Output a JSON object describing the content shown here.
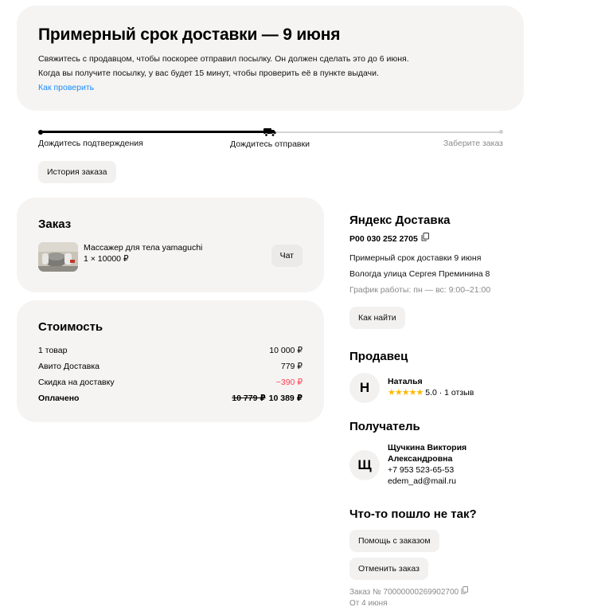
{
  "banner": {
    "title": "Примерный срок доставки — 9 июня",
    "line1": "Свяжитесь с продавцом, чтобы поскорее отправил посылку. Он должен сделать это до 6 июня.",
    "line2": "Когда вы получите посылку, у вас будет 15 минут, чтобы проверить её в пункте выдачи.",
    "link": "Как проверить"
  },
  "progress": {
    "steps": [
      "Дождитесь подтверждения",
      "Дождитесь отправки",
      "Заберите заказ"
    ],
    "current_step": 2
  },
  "history_button": "История заказа",
  "order": {
    "title": "Заказ",
    "item_name": "Массажер для тела yamaguchi",
    "item_qty": "1 × 10000 ₽",
    "chat_button": "Чат"
  },
  "cost": {
    "title": "Стоимость",
    "rows": [
      {
        "label": "1 товар",
        "value": "10 000 ₽"
      },
      {
        "label": "Авито Доставка",
        "value": "779 ₽"
      },
      {
        "label": "Скидка на доставку",
        "value": "−390 ₽"
      }
    ],
    "total_label": "Оплачено",
    "total_old": "10 779 ₽",
    "total_value": "10 389 ₽"
  },
  "delivery": {
    "title": "Яндекс Доставка",
    "tracking": "P00 030 252 2705",
    "eta": "Примерный срок доставки 9 июня",
    "address": "Вологда улица Сергея Преминина 8",
    "schedule": "График работы: пн — вс: 9:00–21:00",
    "find_button": "Как найти"
  },
  "seller": {
    "title": "Продавец",
    "initial": "Н",
    "name": "Наталья",
    "stars": "★★★★★",
    "rating": "5.0 · 1 отзыв"
  },
  "recipient": {
    "title": "Получатель",
    "initial": "Щ",
    "name_line1": "Щучкина Виктория",
    "name_line2": "Александровна",
    "phone": "+7 953 523-65-53",
    "email": "edem_ad@mail.ru"
  },
  "problems": {
    "title": "Что-то пошло не так?",
    "help_button": "Помощь с заказом",
    "cancel_button": "Отменить заказ",
    "order_number": "Заказ № 70000000269902700",
    "order_date": "От 4 июня"
  },
  "colors": {
    "card_bg": "#f5f4f2",
    "link": "#1a8cff",
    "discount": "#ff4053",
    "star": "#ffb800"
  }
}
